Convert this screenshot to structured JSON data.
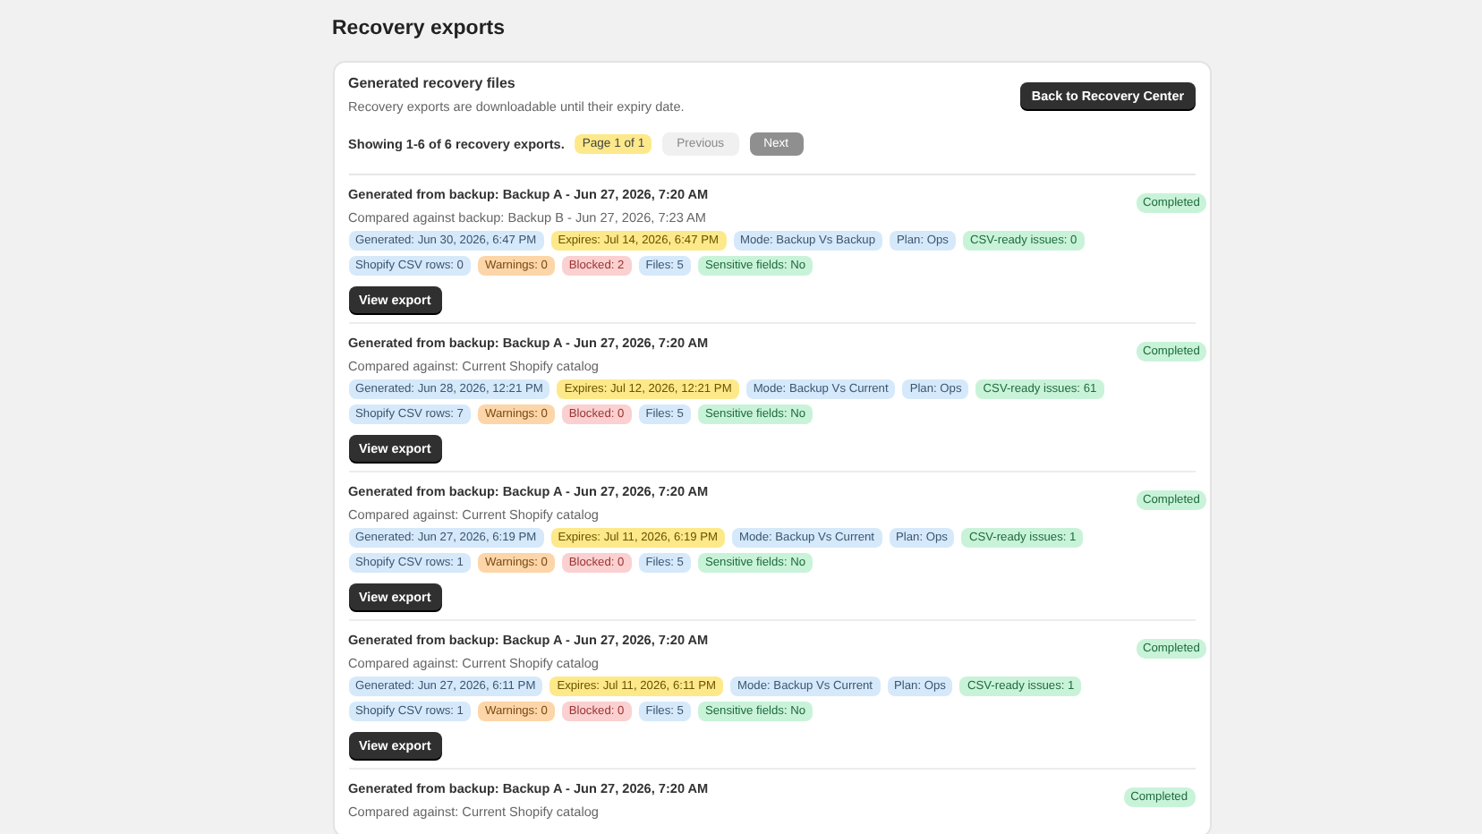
{
  "page_title": "Recovery exports",
  "card": {
    "title": "Generated recovery files",
    "subtitle": "Recovery exports are downloadable until their expiry date.",
    "back_button": "Back to Recovery Center",
    "pagination": {
      "summary": "Showing 1-6 of 6 recovery exports.",
      "page": "Page 1 of 1",
      "previous": {
        "label": "Previous",
        "disabled": true
      },
      "next": {
        "label": "Next",
        "disabled": true
      }
    }
  },
  "exports": [
    {
      "title": "Generated from backup: Backup A - Jun 27, 2026, 7:20 AM",
      "compared": "Compared against backup: Backup B - Jun 27, 2026, 7:23 AM",
      "status": "Completed",
      "tags": [
        {
          "text": "Generated: Jun 30, 2026, 6:47 PM",
          "color": "#d6e9fb"
        },
        {
          "text": "Expires: Jul 14, 2026, 6:47 PM",
          "color": "#fde98a"
        },
        {
          "text": "Mode: Backup Vs Backup",
          "color": "#d6e9fb"
        },
        {
          "text": "Plan: Ops",
          "color": "#d6e9fb"
        },
        {
          "text": "CSV-ready issues: 0",
          "color": "#c9f3d9"
        },
        {
          "text": "Shopify CSV rows: 0",
          "color": "#d6e9fb"
        },
        {
          "text": "Warnings: 0",
          "color": "#fcd5a8"
        },
        {
          "text": "Blocked: 2",
          "color": "#fbd0d0"
        },
        {
          "text": "Files: 5",
          "color": "#d6e9fb"
        },
        {
          "text": "Sensitive fields: No",
          "color": "#c9f3d9"
        }
      ],
      "button": "View export"
    },
    {
      "title": "Generated from backup: Backup A - Jun 27, 2026, 7:20 AM",
      "compared": "Compared against: Current Shopify catalog",
      "status": "Completed",
      "tags": [
        {
          "text": "Generated: Jun 28, 2026, 12:21 PM",
          "color": "#d6e9fb"
        },
        {
          "text": "Expires: Jul 12, 2026, 12:21 PM",
          "color": "#fde98a"
        },
        {
          "text": "Mode: Backup Vs Current",
          "color": "#d6e9fb"
        },
        {
          "text": "Plan: Ops",
          "color": "#d6e9fb"
        },
        {
          "text": "CSV-ready issues: 61",
          "color": "#c9f3d9"
        },
        {
          "text": "Shopify CSV rows: 7",
          "color": "#d6e9fb"
        },
        {
          "text": "Warnings: 0",
          "color": "#fcd5a8"
        },
        {
          "text": "Blocked: 0",
          "color": "#fbd0d0"
        },
        {
          "text": "Files: 5",
          "color": "#d6e9fb"
        },
        {
          "text": "Sensitive fields: No",
          "color": "#c9f3d9"
        }
      ],
      "button": "View export"
    },
    {
      "title": "Generated from backup: Backup A - Jun 27, 2026, 7:20 AM",
      "compared": "Compared against: Current Shopify catalog",
      "status": "Completed",
      "tags": [
        {
          "text": "Generated: Jun 27, 2026, 6:19 PM",
          "color": "#d6e9fb"
        },
        {
          "text": "Expires: Jul 11, 2026, 6:19 PM",
          "color": "#fde98a"
        },
        {
          "text": "Mode: Backup Vs Current",
          "color": "#d6e9fb"
        },
        {
          "text": "Plan: Ops",
          "color": "#d6e9fb"
        },
        {
          "text": "CSV-ready issues: 1",
          "color": "#c9f3d9"
        },
        {
          "text": "Shopify CSV rows: 1",
          "color": "#d6e9fb"
        },
        {
          "text": "Warnings: 0",
          "color": "#fcd5a8"
        },
        {
          "text": "Blocked: 0",
          "color": "#fbd0d0"
        },
        {
          "text": "Files: 5",
          "color": "#d6e9fb"
        },
        {
          "text": "Sensitive fields: No",
          "color": "#c9f3d9"
        }
      ],
      "button": "View export"
    },
    {
      "title": "Generated from backup: Backup A - Jun 27, 2026, 7:20 AM",
      "compared": "Compared against: Current Shopify catalog",
      "status": "Completed",
      "tags": [
        {
          "text": "Generated: Jun 27, 2026, 6:11 PM",
          "color": "#d6e9fb"
        },
        {
          "text": "Expires: Jul 11, 2026, 6:11 PM",
          "color": "#fde98a"
        },
        {
          "text": "Mode: Backup Vs Current",
          "color": "#d6e9fb"
        },
        {
          "text": "Plan: Ops",
          "color": "#d6e9fb"
        },
        {
          "text": "CSV-ready issues: 1",
          "color": "#c9f3d9"
        },
        {
          "text": "Shopify CSV rows: 1",
          "color": "#d6e9fb"
        },
        {
          "text": "Warnings: 0",
          "color": "#fcd5a8"
        },
        {
          "text": "Blocked: 0",
          "color": "#fbd0d0"
        },
        {
          "text": "Files: 5",
          "color": "#d6e9fb"
        },
        {
          "text": "Sensitive fields: No",
          "color": "#c9f3d9"
        }
      ],
      "button": "View export"
    },
    {
      "title": "Generated from backup: Backup A - Jun 27, 2026, 7:20 AM",
      "compared": "Compared against: Current Shopify catalog",
      "status": "Completed"
    }
  ]
}
